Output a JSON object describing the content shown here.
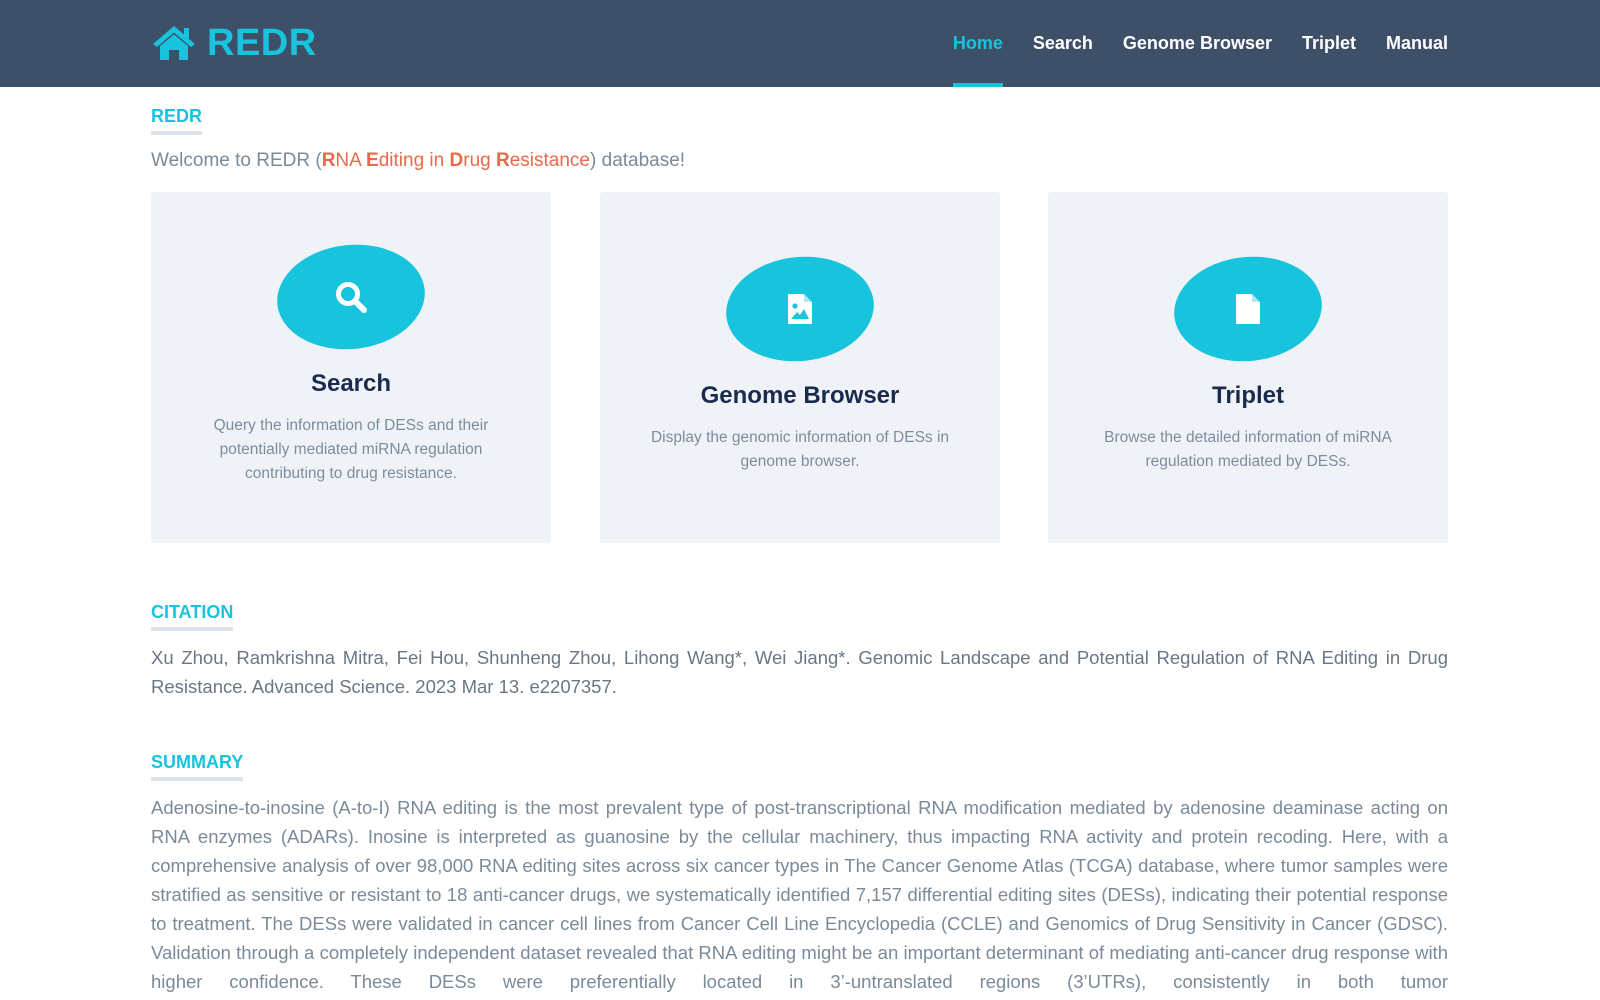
{
  "navbar": {
    "brand": "REDR",
    "items": [
      {
        "label": "Home",
        "active": true
      },
      {
        "label": "Search"
      },
      {
        "label": "Genome Browser"
      },
      {
        "label": "Triplet"
      },
      {
        "label": "Manual"
      }
    ]
  },
  "intro": {
    "section_label": "REDR",
    "welcome_prefix": "Welcome to REDR (",
    "acronym_parts": [
      {
        "letter": "R",
        "rest": "NA "
      },
      {
        "letter": "E",
        "rest": "diting in "
      },
      {
        "letter": "D",
        "rest": "rug "
      },
      {
        "letter": "R",
        "rest": "esistance"
      }
    ],
    "welcome_suffix": ") database!"
  },
  "cards": [
    {
      "icon": "search-icon",
      "title": "Search",
      "description": "Query the information of DESs and their potentially mediated miRNA regulation contributing to drug resistance."
    },
    {
      "icon": "file-image-icon",
      "title": "Genome Browser",
      "description": "Display the genomic information of DESs in genome browser."
    },
    {
      "icon": "file-icon",
      "title": "Triplet",
      "description": "Browse the detailed information of miRNA regulation mediated by DESs."
    }
  ],
  "citation": {
    "section_label": "CITATION",
    "text": "Xu Zhou, Ramkrishna Mitra, Fei Hou, Shunheng Zhou, Lihong Wang*, Wei Jiang*. Genomic Landscape and Potential Regulation of RNA Editing in Drug Resistance. Advanced Science. 2023 Mar 13. e2207357."
  },
  "summary": {
    "section_label": "SUMMARY",
    "text": "Adenosine-to-inosine (A-to-I) RNA editing is the most prevalent type of post-transcriptional RNA modification mediated by adenosine deaminase acting on RNA enzymes (ADARs). Inosine is interpreted as guanosine by the cellular machinery, thus impacting RNA activity and protein recoding. Here, with a comprehensive analysis of over 98,000 RNA editing sites across six cancer types in The Cancer Genome Atlas (TCGA) database, where tumor samples were stratified as sensitive or resistant to 18 anti-cancer drugs, we systematically identified 7,157 differential editing sites (DESs), indicating their potential response to treatment. The DESs were validated in cancer cell lines from Cancer Cell Line Encyclopedia (CCLE) and Genomics of Drug Sensitivity in Cancer (GDSC). Validation through a completely independent dataset revealed that RNA editing might be an important determinant of mediating anti-cancer drug response with higher confidence. These DESs were preferentially located in 3’-untranslated regions (3’UTRs), consistently in both tumor"
  },
  "colors": {
    "navbar_bg": "#3d5068",
    "accent": "#17c3dd",
    "highlight": "#e8694a",
    "card_bg": "#eff3f8",
    "card_title": "#1b2b4d"
  }
}
